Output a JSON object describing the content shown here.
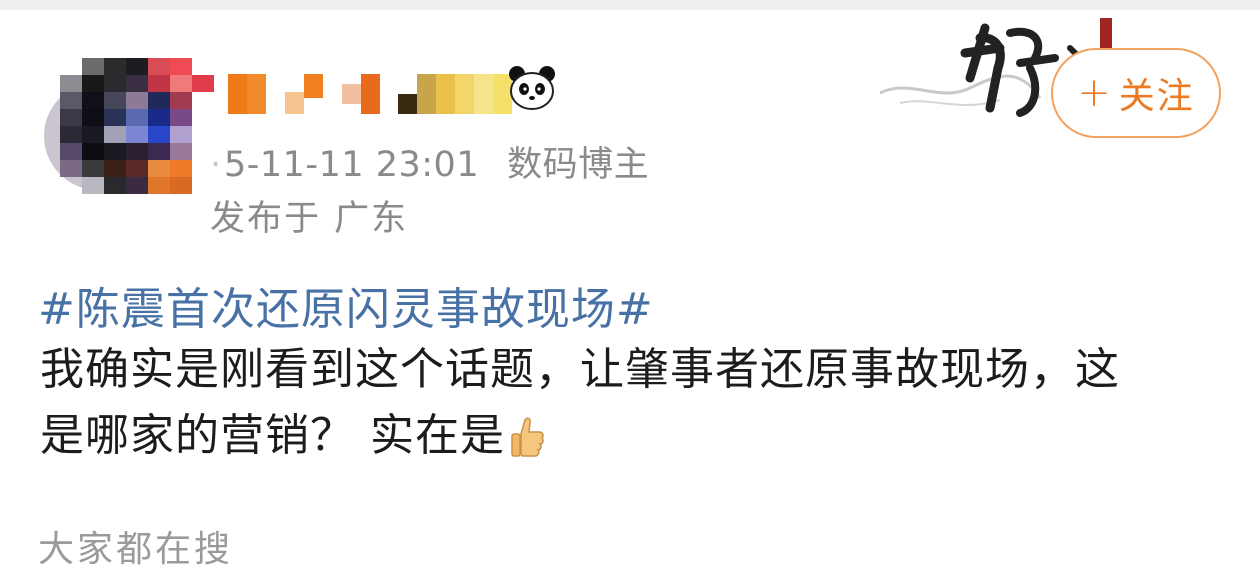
{
  "post": {
    "timestamp": "5-11-11 23:01",
    "category": "数码博主",
    "location": "发布于 广东",
    "follow_label": "关注",
    "follow_icon": "plus-icon",
    "topic": "#陈震首次还原闪灵事故现场#",
    "body_lines": [
      "我确实是刚看到这个话题，让肇事者还原事故现场，这",
      "是哪家的营销？ 实在是"
    ],
    "emoji": "thumbs-up-icon",
    "badge_icon": "panda-icon"
  },
  "comments": {
    "peek_text": "大家都在搜"
  },
  "colors": {
    "accent_orange": "#ec7a24",
    "follow_border": "#f3a25d",
    "topic_blue": "#4872a6",
    "meta_gray": "#8a8a8a"
  }
}
